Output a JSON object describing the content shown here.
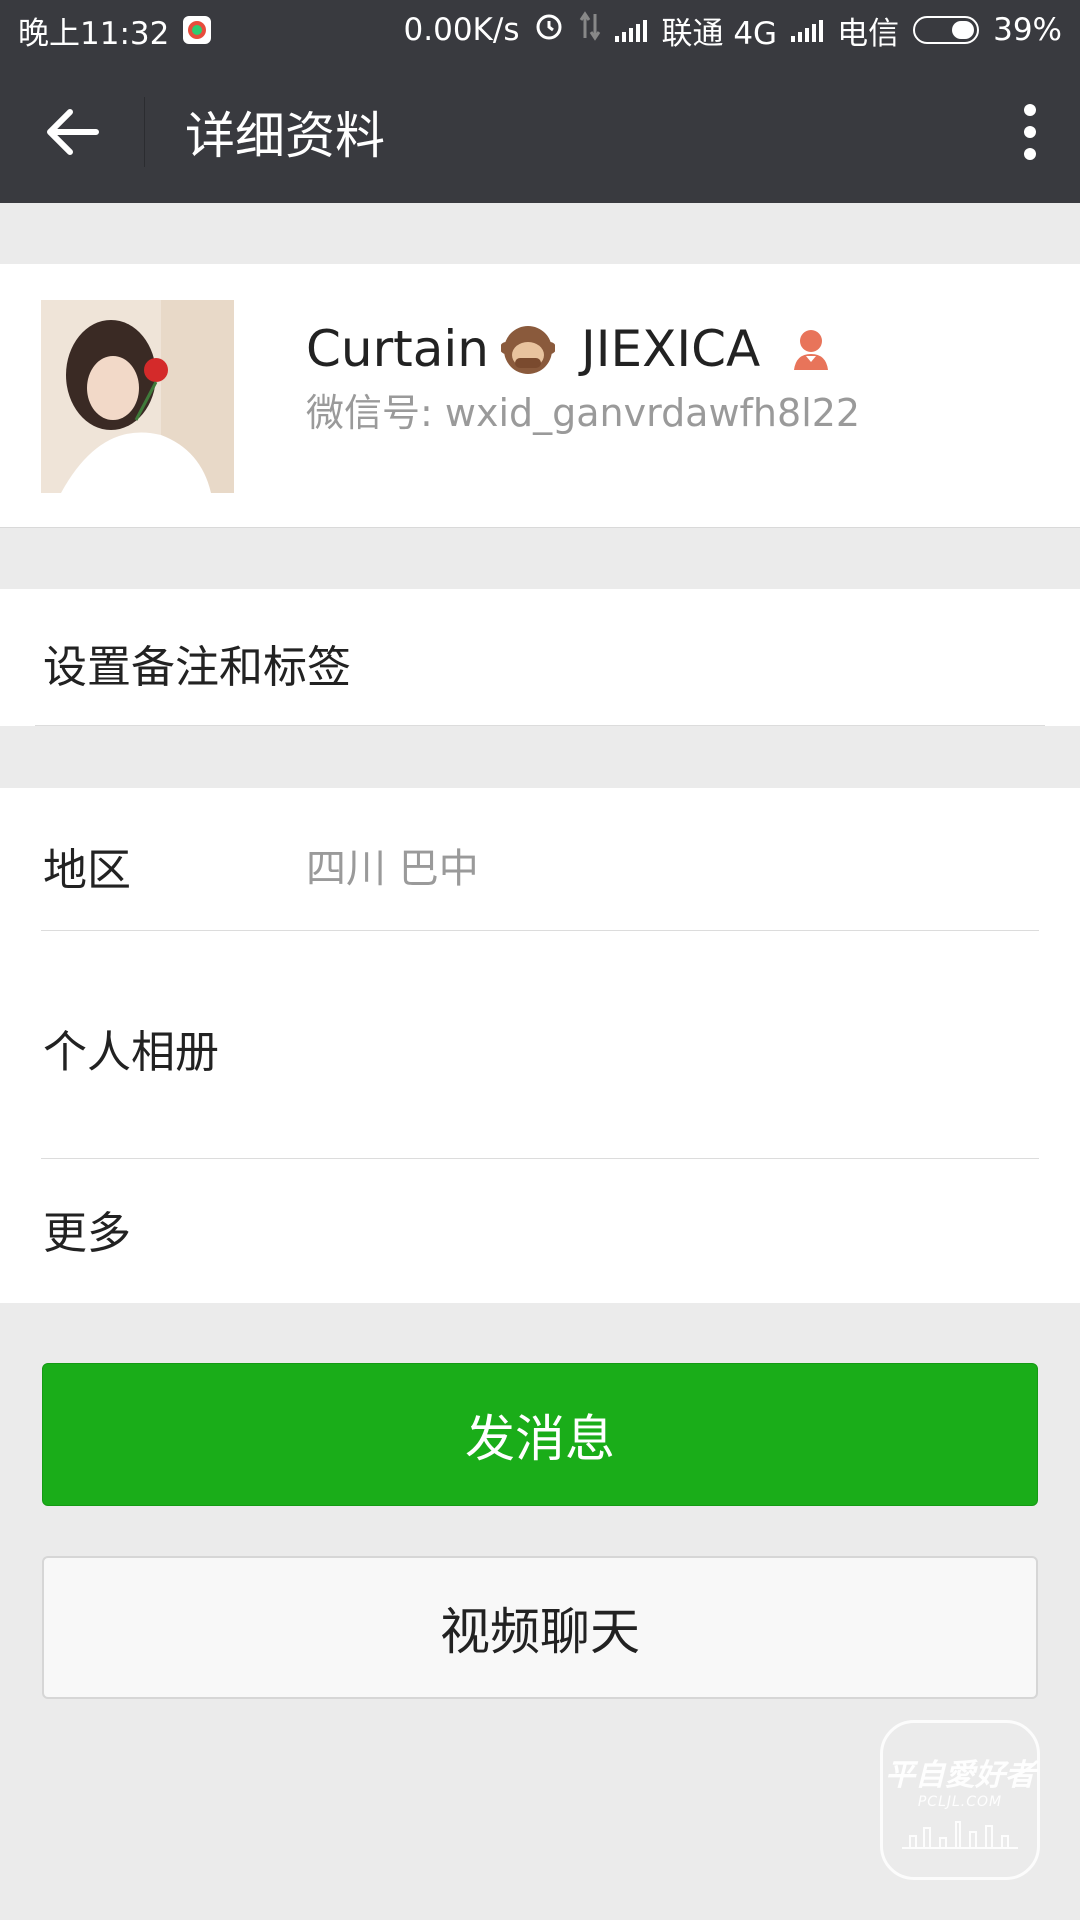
{
  "status_bar": {
    "time": "晚上11:32",
    "speed": "0.00K/s",
    "carrier1": "联通 4G",
    "carrier2": "电信",
    "battery": "39%",
    "battery_level": 0.39
  },
  "title_bar": {
    "title": "详细资料"
  },
  "profile": {
    "name_part1": "Curtain",
    "name_part2": "JIEXICA",
    "wxid": "微信号: wxid_ganvrdawfh8l22",
    "gender_icon": "female-icon",
    "emoji_icon": "see-no-evil-monkey-icon"
  },
  "remark": {
    "label": "设置备注和标签"
  },
  "info": {
    "region_label": "地区",
    "region_value": "四川  巴中",
    "album_label": "个人相册",
    "more_label": "更多"
  },
  "buttons": {
    "send_message": "发消息",
    "video_chat": "视频聊天"
  },
  "watermark": {
    "main": "平自愛好者",
    "sub": "PCLJL.COM"
  },
  "colors": {
    "header_bg": "#393a3f",
    "accent_green": "#1aad19",
    "page_bg": "#ebebeb"
  }
}
